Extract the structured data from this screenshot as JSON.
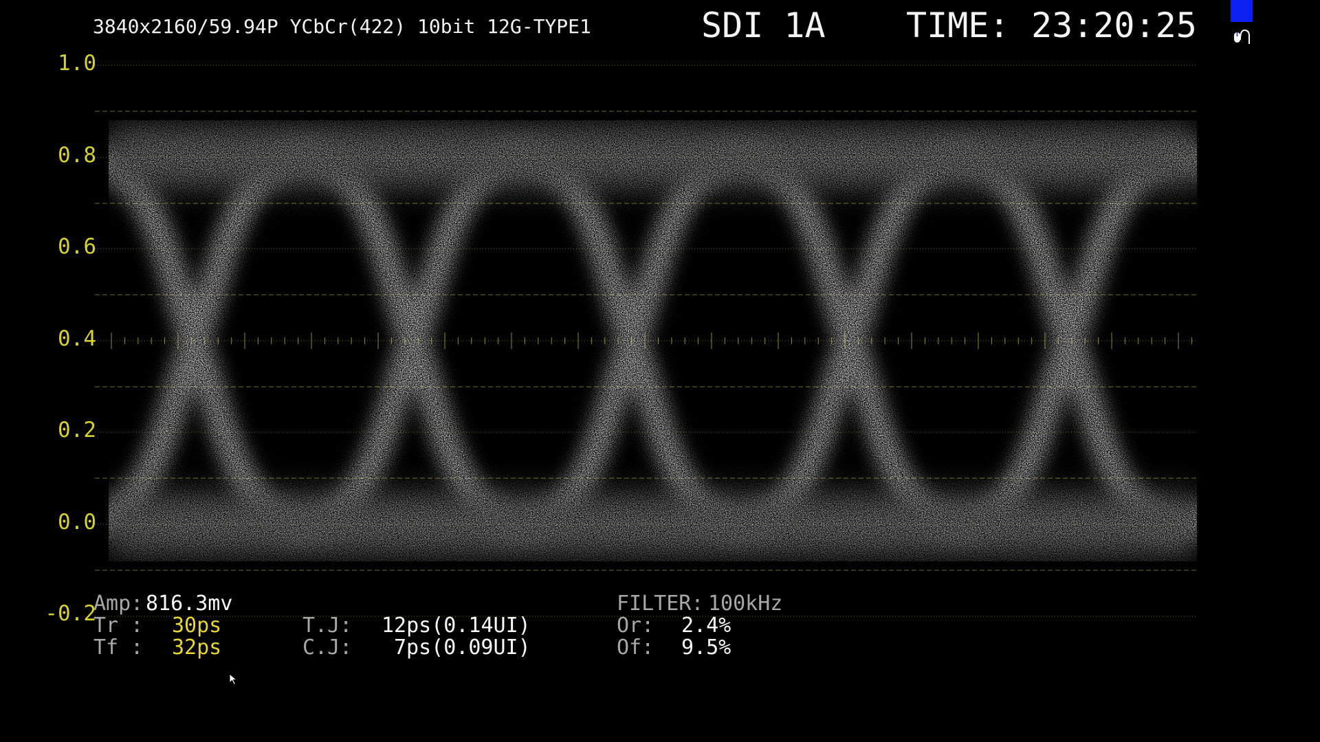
{
  "header": {
    "format": "3840x2160/59.94P YCbCr(422) 10bit 12G-TYPE1",
    "channel": "SDI 1A",
    "time_label": "TIME:",
    "time_value": "23:20:25",
    "mouse_icon": "mouse-icon"
  },
  "colors": {
    "background": "#000000",
    "scale_yellow": "#d7d12f",
    "trace_white": "#ffffff",
    "badge_blue": "#0a1ff0"
  },
  "chart_data": {
    "type": "eye-diagram",
    "y_ticks": [
      "1.0",
      "0.8",
      "0.6",
      "0.4",
      "0.2",
      "0.0",
      "-0.2"
    ],
    "ylim": [
      -0.2,
      1.0
    ],
    "eye_level_high": 0.8,
    "eye_level_low": 0.0,
    "crossing_level": 0.4,
    "unit_intervals_visible": 5
  },
  "measurements": {
    "amp_label": "Amp:",
    "amp_value": "816.3mv",
    "tr_label": "Tr :",
    "tr_value": "30ps",
    "tf_label": "Tf :",
    "tf_value": "32ps",
    "tj_label": "T.J:",
    "tj_value": "12ps(0.14UI)",
    "cj_label": "C.J:",
    "cj_value": "7ps(0.09UI)",
    "filter_label": "FILTER:",
    "filter_value": "100kHz",
    "or_label": "Or:",
    "or_value": "2.4%",
    "of_label": "Of:",
    "of_value": "9.5%"
  }
}
